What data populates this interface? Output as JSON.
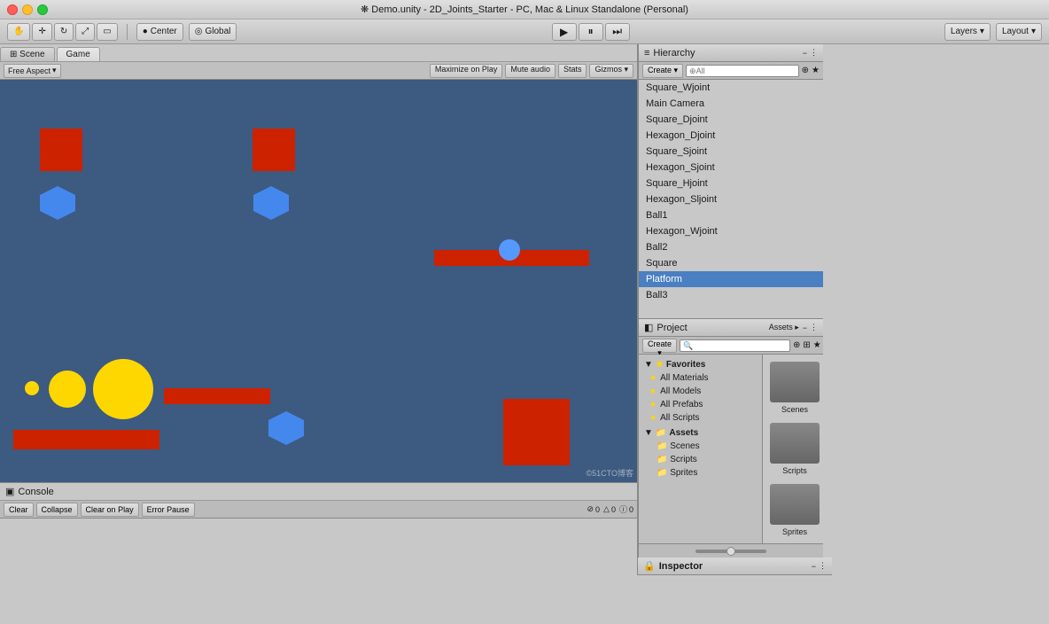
{
  "titlebar": {
    "title": "❋ Demo.unity - 2D_Joints_Starter - PC, Mac & Linux Standalone (Personal)"
  },
  "toolbar": {
    "center_label": "Center",
    "global_label": "Global",
    "layers_label": "Layers",
    "layout_label": "Layout",
    "play_icon": "▶",
    "pause_icon": "⏸",
    "step_icon": "⏭"
  },
  "scene_tab": "Scene",
  "game_tab": "Game",
  "game_toolbar": {
    "aspect_label": "Free Aspect",
    "maximize_label": "Maximize on Play",
    "mute_label": "Mute audio",
    "stats_label": "Stats",
    "gizmos_label": "Gizmos ▾"
  },
  "hierarchy": {
    "title": "Hierarchy",
    "create_label": "Create ▾",
    "search_placeholder": "⊕All",
    "items": [
      {
        "label": "Square_Wjoint",
        "selected": false
      },
      {
        "label": "Main Camera",
        "selected": false
      },
      {
        "label": "Square_Djoint",
        "selected": false
      },
      {
        "label": "Hexagon_Djoint",
        "selected": false
      },
      {
        "label": "Square_Sjoint",
        "selected": false
      },
      {
        "label": "Hexagon_Sjoint",
        "selected": false
      },
      {
        "label": "Square_Hjoint",
        "selected": false
      },
      {
        "label": "Hexagon_Sljoint",
        "selected": false
      },
      {
        "label": "Ball1",
        "selected": false
      },
      {
        "label": "Hexagon_Wjoint",
        "selected": false
      },
      {
        "label": "Ball2",
        "selected": false
      },
      {
        "label": "Square",
        "selected": false
      },
      {
        "label": "Platform",
        "selected": true
      },
      {
        "label": "Ball3",
        "selected": false
      }
    ]
  },
  "project": {
    "title": "Project",
    "create_label": "Create ▾",
    "assets_label": "Assets ▸",
    "favorites_label": "Favorites",
    "all_materials_label": "All Materials",
    "all_models_label": "All Models",
    "all_prefabs_label": "All Prefabs",
    "all_scripts_label": "All Scripts",
    "assets_section_label": "Assets",
    "scenes_label": "Scenes",
    "scripts_label": "Scripts",
    "sprites_label": "Sprites",
    "folders": [
      {
        "label": "Scenes"
      },
      {
        "label": "Scripts"
      },
      {
        "label": "Sprites"
      }
    ]
  },
  "inspector": {
    "title": "Inspector"
  },
  "console": {
    "title": "Console",
    "clear_label": "Clear",
    "collapse_label": "Collapse",
    "clear_on_play_label": "Clear on Play",
    "error_pause_label": "Error Pause",
    "error_count": "0",
    "warning_count": "0",
    "info_count": "0"
  },
  "watermark": "©51CTO博客",
  "colors": {
    "viewport_bg": "#3d5a80",
    "red": "#cc2200",
    "blue": "#4499ff",
    "yellow": "#ffd700",
    "panel_bg": "#c0c0c0"
  }
}
